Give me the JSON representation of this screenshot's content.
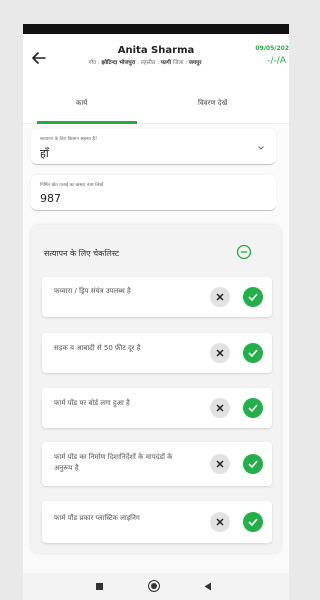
{
  "header": {
    "name": "Anita Sharma",
    "village_label": "गाँव :",
    "village": "झोटिन्दा भोजपुरा",
    "tehsil_label": ", तहसील :",
    "tehsil": "फागी",
    "district_label": "जिला :",
    "district": "जयपुर",
    "date": "09/05/202",
    "code": "-/-/A"
  },
  "tabs": [
    {
      "label": "कार्य",
      "active": true
    },
    {
      "label": "विवरण देखें",
      "active": false
    }
  ],
  "fields": [
    {
      "label": "सत्यापन के लिए किसान सहमत है?",
      "value": "हाँ",
      "type": "dropdown"
    },
    {
      "label": "निर्मित खेत तलाई का खसरा नंबर लिखें",
      "value": "987",
      "type": "text"
    }
  ],
  "checklist": {
    "title": "सत्यापन के लिए चेकलिस्ट",
    "items": [
      {
        "text": "फव्वारा / ड्रिप संयंत्र उपलब्ध है"
      },
      {
        "text": "सड़क व आबादी से 50 फ़ीट दूर है"
      },
      {
        "text": "फार्म पोंड पर बोर्ड लगा हुआ है"
      },
      {
        "text": "फार्म पोंड का निर्माण दिशानिर्देशों के मापदंडों के अनुरूप है"
      },
      {
        "text": "फार्म पौंड प्रकार प्लास्टिक लाइनिंग"
      }
    ]
  },
  "colors": {
    "accent": "#28a745",
    "ok_button": "#23b04a",
    "reject_button": "#e2e2e2"
  },
  "icons": {
    "back": "arrow-left-icon",
    "collapse": "minus-circle-icon",
    "dropdown": "chevron-down-icon",
    "reject": "close-icon",
    "accept": "check-icon",
    "nav_recents": "square-icon",
    "nav_home": "circle-icon",
    "nav_back": "triangle-left-icon"
  }
}
